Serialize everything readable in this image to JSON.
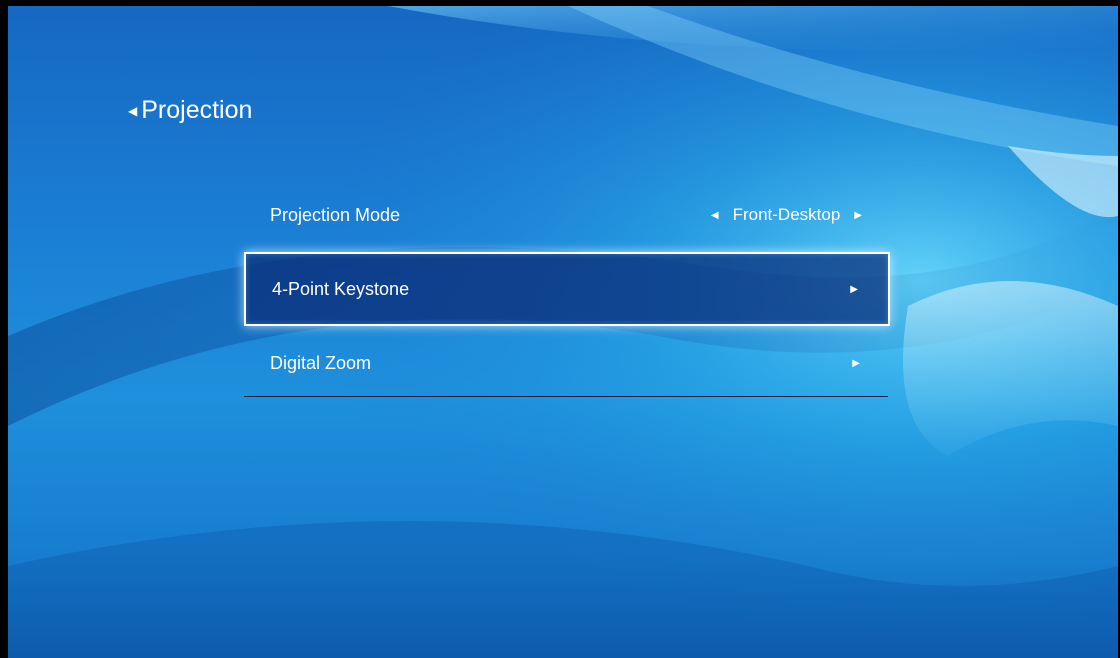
{
  "header": {
    "title": "Projection",
    "back_icon": "chevron-left-icon"
  },
  "menu": {
    "items": [
      {
        "label": "Projection Mode",
        "value": "Front-Desktop",
        "selected": false
      },
      {
        "label": "4-Point Keystone",
        "value": "",
        "selected": true
      },
      {
        "label": "Digital Zoom",
        "value": "",
        "selected": false
      }
    ]
  },
  "colors": {
    "background": "#1b7fd4",
    "selection_border": "#ffffff",
    "selection_fill": "#0a2d78",
    "text": "#ffffff"
  }
}
